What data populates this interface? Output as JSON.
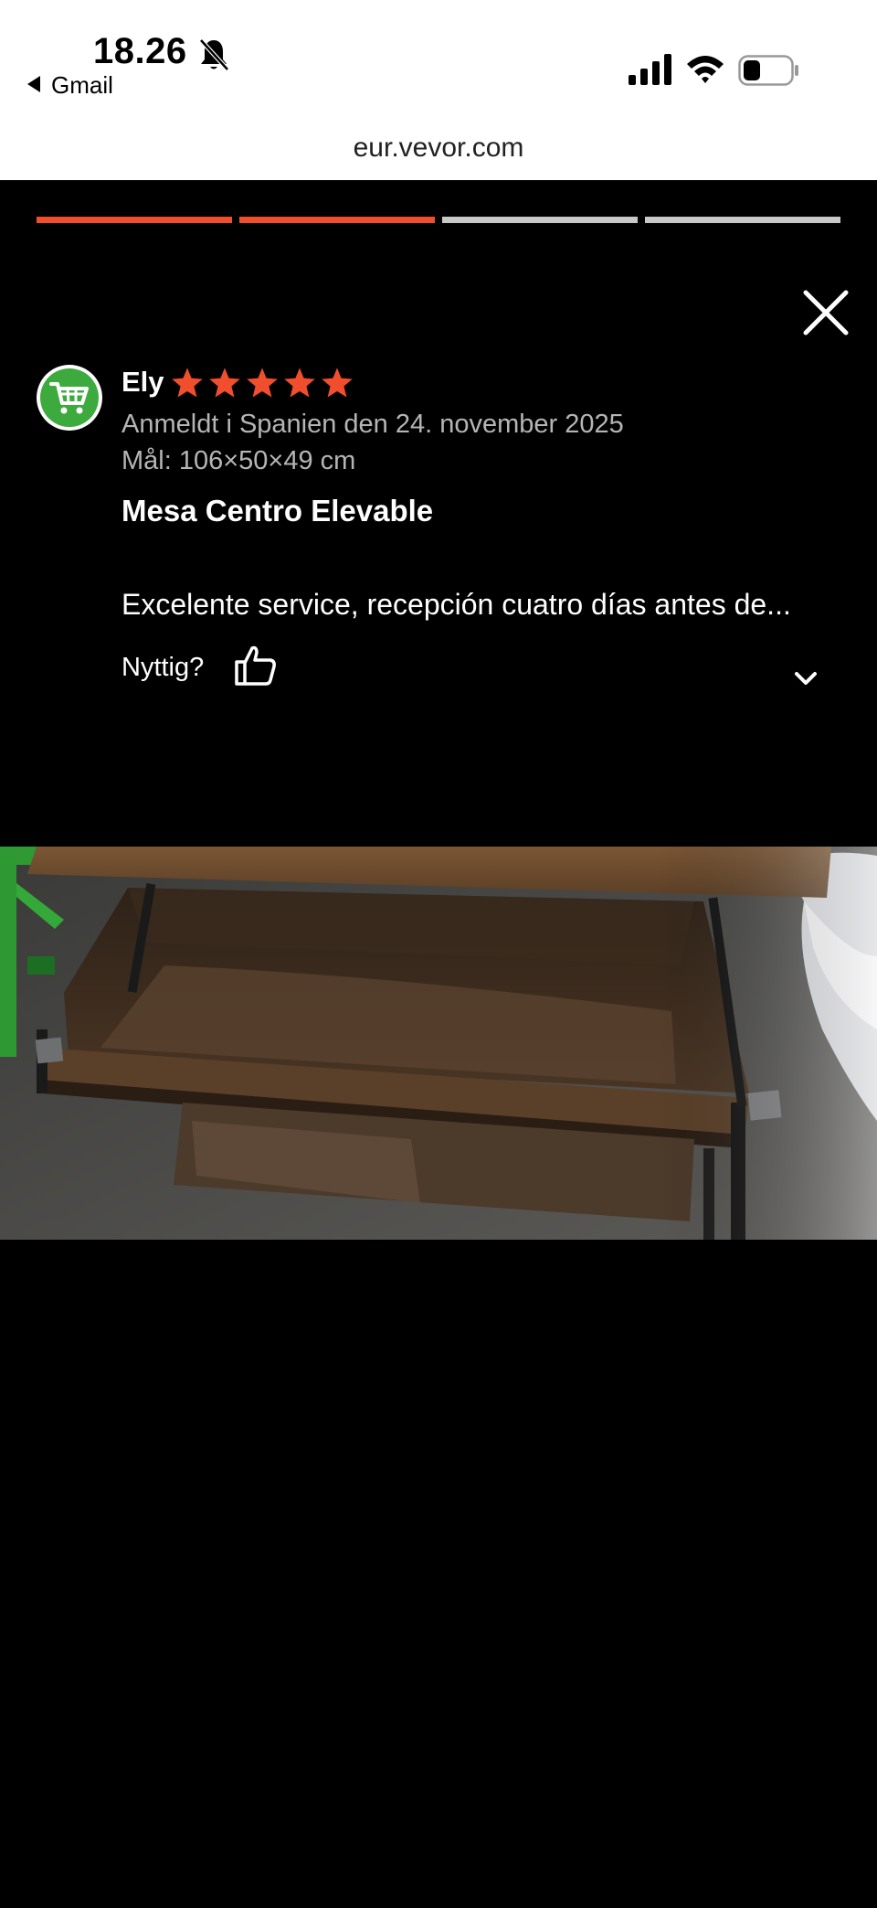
{
  "status_bar": {
    "time": "18.26",
    "back_app": "Gmail"
  },
  "browser": {
    "url": "eur.vevor.com"
  },
  "story": {
    "progress": {
      "total_segments": 4,
      "completed_segments": 2
    },
    "accent_color": "#f04e2d"
  },
  "review": {
    "author": "Ely",
    "rating": 5,
    "reviewed_in": "Anmeldt i Spanien den 24. november 2025",
    "size": "Mål: 106×50×49 cm",
    "title": "Mesa Centro Elevable",
    "body": "Excelente service, recepción cuatro días antes de...",
    "helpful_label": "Nyttig?",
    "avatar_icon": "shopping-cart-icon"
  },
  "colors": {
    "star": "#f04e2d",
    "avatar_bg": "#3daa3d"
  }
}
